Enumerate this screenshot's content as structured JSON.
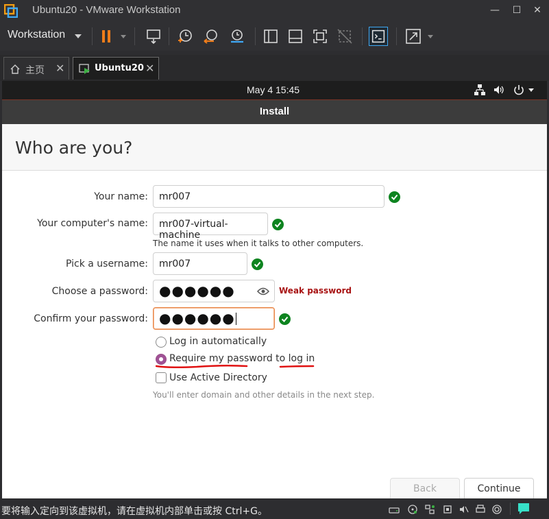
{
  "window": {
    "title": "Ubuntu20 - VMware Workstation",
    "controls": {
      "minimize": "—",
      "maximize": "☐",
      "close": "✕"
    }
  },
  "toolbar": {
    "menu_label": "Workstation"
  },
  "tabs": [
    {
      "label": "主页",
      "icon": "home-icon"
    },
    {
      "label": "Ubuntu20",
      "icon": "vm-play-icon"
    }
  ],
  "guest_topbar": {
    "clock": "May 4  15:45"
  },
  "installer": {
    "header": "Install",
    "title": "Who are you?",
    "fields": {
      "name": {
        "label": "Your name:",
        "value": "mr007"
      },
      "computer": {
        "label": "Your computer's name:",
        "value": "mr007-virtual-machine",
        "hint": "The name it uses when it talks to other computers."
      },
      "username": {
        "label": "Pick a username:",
        "value": "mr007"
      },
      "password": {
        "label": "Choose a password:",
        "value": "●●●●●●",
        "strength": "Weak password"
      },
      "confirm": {
        "label": "Confirm your password:",
        "value": "●●●●●●"
      }
    },
    "options": {
      "auto_login": "Log in automatically",
      "require_password": "Require my password to log in",
      "active_directory": "Use Active Directory",
      "ad_hint": "You'll enter domain and other details in the next step."
    },
    "buttons": {
      "back": "Back",
      "continue": "Continue"
    }
  },
  "statusbar": {
    "message": "要将输入定向到该虚拟机，请在虚拟机内部单击或按 Ctrl+G。"
  },
  "colors": {
    "accent_orange": "#e8894d",
    "check_green": "#0e8420",
    "radio_purple": "#a05296",
    "weak_red": "#a81212",
    "annotation_red": "#e01010"
  }
}
